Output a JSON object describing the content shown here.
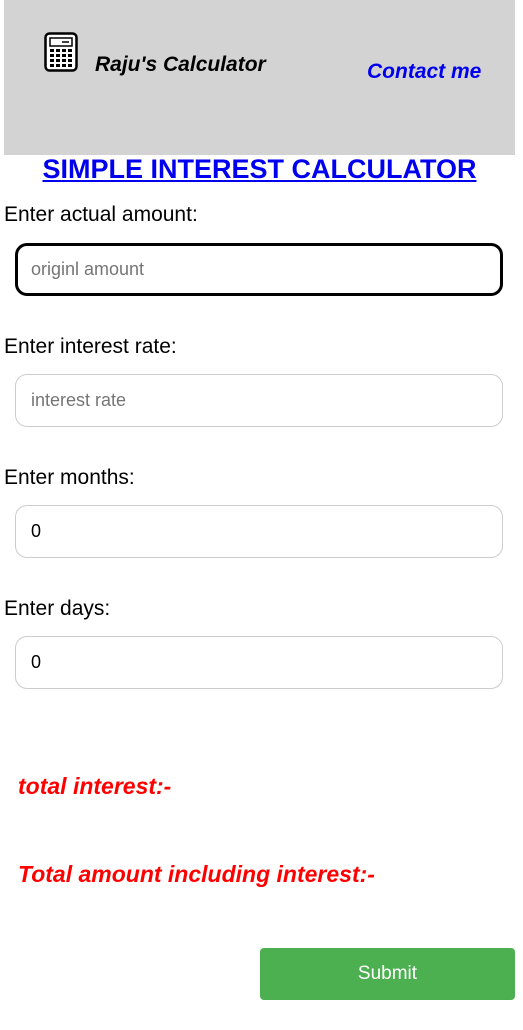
{
  "header": {
    "logo_icon": "calculator-icon",
    "brand": "Raju's Calculator",
    "contact_link": "Contact me",
    "background_color": "#d3d3d3"
  },
  "title": "SIMPLE INTEREST CALCULATOR",
  "form": {
    "amount": {
      "label": "Enter actual amount:",
      "placeholder": "originl amount",
      "value": ""
    },
    "rate": {
      "label": "Enter interest rate:",
      "placeholder": "interest rate",
      "value": ""
    },
    "months": {
      "label": "Enter months:",
      "value": "0"
    },
    "days": {
      "label": "Enter days:",
      "value": "0"
    }
  },
  "results": {
    "total_interest": "total interest:-",
    "total_amount": "Total amount including interest:-",
    "color": "#ff0000"
  },
  "submit_label": "Submit",
  "colors": {
    "link": "#0000ee",
    "submit": "#4caf50"
  }
}
